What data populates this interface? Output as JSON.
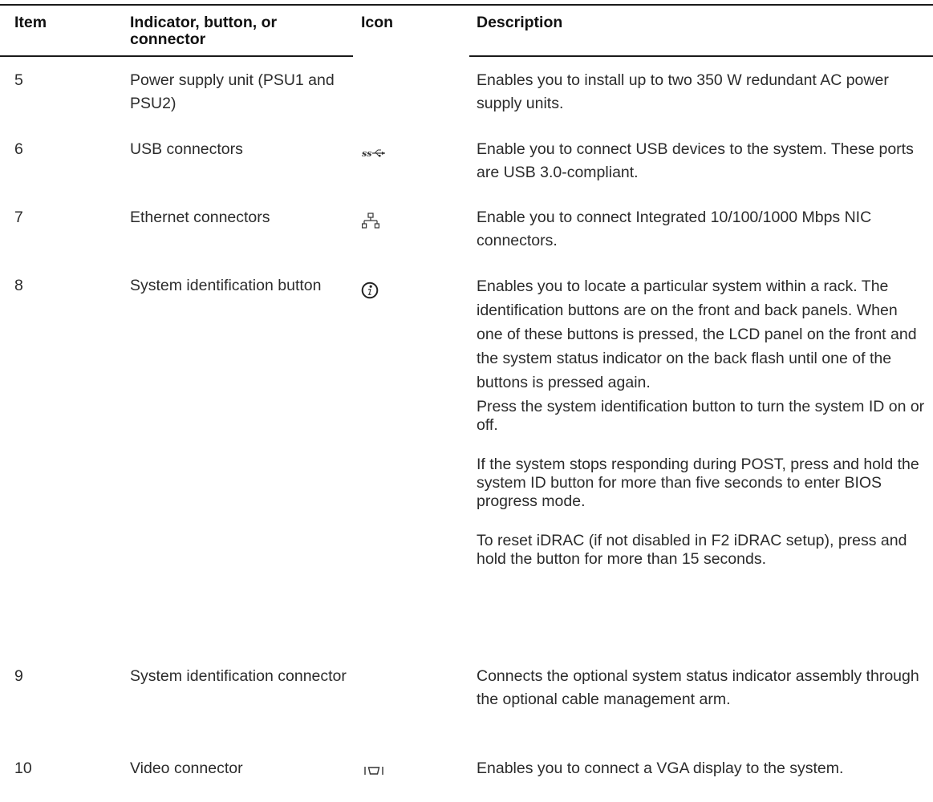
{
  "table": {
    "headers": {
      "item": "Item",
      "indicator": "Indicator, button, or connector",
      "icon": "Icon",
      "description": "Description"
    },
    "rows": [
      {
        "item": "5",
        "indicator": "Power supply unit (PSU1 and PSU2)",
        "icon": "",
        "description": [
          "Enables you to install up to two 350 W redundant AC power supply units."
        ]
      },
      {
        "item": "6",
        "indicator": "USB connectors",
        "icon": "usb-superspeed-icon",
        "description": [
          "Enable you to connect USB devices to the system. These ports are USB 3.0-compliant."
        ]
      },
      {
        "item": "7",
        "indicator": "Ethernet connectors",
        "icon": "network-icon",
        "description": [
          "Enable you to connect Integrated 10/100/1000 Mbps NIC connectors."
        ]
      },
      {
        "item": "8",
        "indicator": "System identification button",
        "icon": "info-icon",
        "description": [
          "Enables you to locate a particular system within a rack. The identification buttons are on the front and back panels. When one of these buttons is pressed, the LCD panel on the front and the system status indicator on the back flash until one of the buttons is pressed again.",
          "Press the system identification button to turn the system ID on or off.",
          "If the system stops responding during POST, press and hold the system ID button for more than five seconds to enter BIOS progress mode.",
          "To reset iDRAC (if not disabled in F2 iDRAC setup), press and hold the button for more than 15 seconds."
        ]
      },
      {
        "item": "9",
        "indicator": "System identification connector",
        "icon": "",
        "description": [
          "Connects the optional system status indicator assembly through the optional cable management arm."
        ]
      },
      {
        "item": "10",
        "indicator": "Video connector",
        "icon": "vga-port-icon",
        "description": [
          "Enables you to connect a VGA display to the system."
        ]
      }
    ]
  }
}
